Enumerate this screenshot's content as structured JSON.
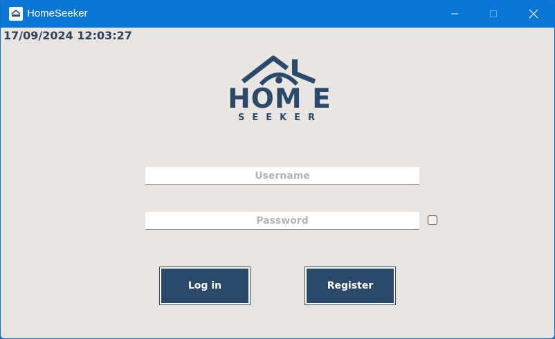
{
  "window": {
    "title": "HomeSeeker",
    "app_icon": "homeseeker-logo-icon"
  },
  "datetime": "17/09/2024 12:03:27",
  "logo": {
    "title": "HOM E",
    "subtitle": "SEEKER"
  },
  "form": {
    "username_placeholder": "Username",
    "password_placeholder": "Password",
    "show_password_checked": false
  },
  "buttons": {
    "login": "Log in",
    "register": "Register"
  },
  "colors": {
    "titlebar": "#0a76d6",
    "brand": "#2b4a6a",
    "background": "#e7e4e1"
  }
}
